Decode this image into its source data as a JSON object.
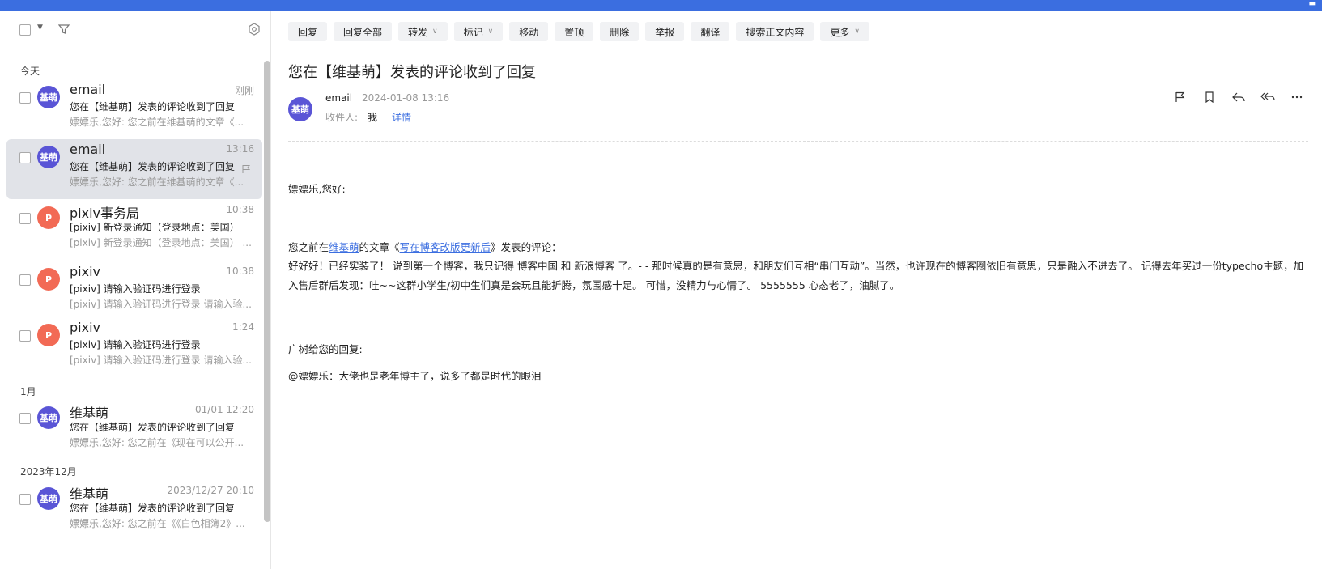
{
  "list": {
    "groups": [
      "今天",
      "1月",
      "2023年12月"
    ],
    "items": [
      {
        "avatar": "基萌",
        "color": "#5a55d6",
        "sender": "email",
        "time": "刚刚",
        "subject": "您在【维基萌】发表的评论收到了回复",
        "preview": "嫖嫖乐,您好: 您之前在维基萌的文章《..."
      },
      {
        "avatar": "基萌",
        "color": "#5a55d6",
        "sender": "email",
        "time": "13:16",
        "subject": "您在【维基萌】发表的评论收到了回复",
        "preview": "嫖嫖乐,您好: 您之前在维基萌的文章《..."
      },
      {
        "avatar": "P",
        "color": "#f26a55",
        "sender": "pixiv事务局",
        "time": "10:38",
        "subject": "[pixiv] 新登录通知（登录地点：美国）",
        "preview": "[pixiv] 新登录通知（登录地点：美国） ..."
      },
      {
        "avatar": "P",
        "color": "#f26a55",
        "sender": "pixiv",
        "time": "10:38",
        "subject": "[pixiv] 请输入验证码进行登录",
        "preview": "[pixiv] 请输入验证码进行登录 请输入验..."
      },
      {
        "avatar": "P",
        "color": "#f26a55",
        "sender": "pixiv",
        "time": "1:24",
        "subject": "[pixiv] 请输入验证码进行登录",
        "preview": "[pixiv] 请输入验证码进行登录 请输入验..."
      },
      {
        "avatar": "基萌",
        "color": "#5a55d6",
        "sender": "维基萌",
        "time": "01/01 12:20",
        "subject": "您在【维基萌】发表的评论收到了回复",
        "preview": "嫖嫖乐,您好: 您之前在《现在可以公开..."
      },
      {
        "avatar": "基萌",
        "color": "#5a55d6",
        "sender": "维基萌",
        "time": "2023/12/27 20:10",
        "subject": "您在【维基萌】发表的评论收到了回复",
        "preview": "嫖嫖乐,您好: 您之前在《《白色相簿2》..."
      }
    ]
  },
  "toolbar": {
    "buttons": [
      "回复",
      "回复全部",
      "转发",
      "标记",
      "移动",
      "置顶",
      "删除",
      "举报",
      "翻译",
      "搜索正文内容",
      "更多"
    ]
  },
  "mail": {
    "title": "您在【维基萌】发表的评论收到了回复",
    "avatar": "基萌",
    "from": "email",
    "date": "2024-01-08 13:16",
    "to_label": "收件人:",
    "to": "我",
    "detail": "详情",
    "greeting": "嫖嫖乐,您好:",
    "line1_pre": "您之前在",
    "line1_site": "维基萌",
    "line1_mid": "的文章《",
    "line1_article": "写在博客改版更新后",
    "line1_post": "》发表的评论：",
    "comment": "好好好！已经实装了！ 说到第一个博客，我只记得 博客中国 和 新浪博客 了。- - 那时候真的是有意思，和朋友们互相“串门互动”。当然，也许现在的博客圈依旧有意思，只是融入不进去了。 记得去年买过一份typecho主题，加入售后群后发现：哇~~这群小学生/初中生们真是会玩且能折腾，氛围感十足。 可惜，没精力与心情了。 5555555 心态老了，油腻了。",
    "reply_label": "广树给您的回复:",
    "reply": "@嫖嫖乐：大佬也是老年博主了，说多了都是时代的眼泪"
  }
}
